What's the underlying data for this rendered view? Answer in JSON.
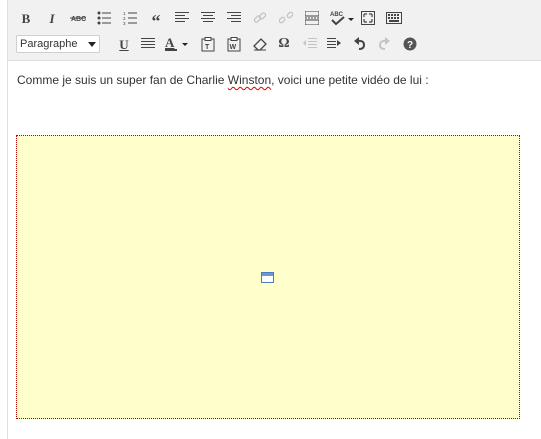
{
  "toolbar": {
    "row1": [
      {
        "name": "bold-button",
        "glyph": "B"
      },
      {
        "name": "italic-button",
        "glyph": "I"
      },
      {
        "name": "strikethrough-button",
        "glyph": "ABC"
      },
      {
        "name": "bullet-list-button",
        "glyph": "bullets"
      },
      {
        "name": "numbered-list-button",
        "glyph": "numbers"
      },
      {
        "name": "blockquote-button",
        "glyph": "“"
      },
      {
        "name": "align-left-button",
        "glyph": "align-left"
      },
      {
        "name": "align-center-button",
        "glyph": "align-center"
      },
      {
        "name": "align-right-button",
        "glyph": "align-right"
      },
      {
        "name": "insert-link-button",
        "glyph": "link",
        "disabled": true
      },
      {
        "name": "unlink-button",
        "glyph": "unlink",
        "disabled": true
      },
      {
        "name": "insert-more-tag-button",
        "glyph": "more"
      },
      {
        "name": "spellcheck-button",
        "glyph": "ABC✓"
      },
      {
        "name": "fullscreen-button",
        "glyph": "fullscreen"
      },
      {
        "name": "kitchen-sink-button",
        "glyph": "kitchen"
      }
    ],
    "row2": {
      "format_select_value": "Paragraphe"
    }
  },
  "content": {
    "text_before": "Comme je suis un super fan de Charlie ",
    "text_misspelled": "Winston",
    "text_after": ", voici une petite vidéo de lui :"
  }
}
